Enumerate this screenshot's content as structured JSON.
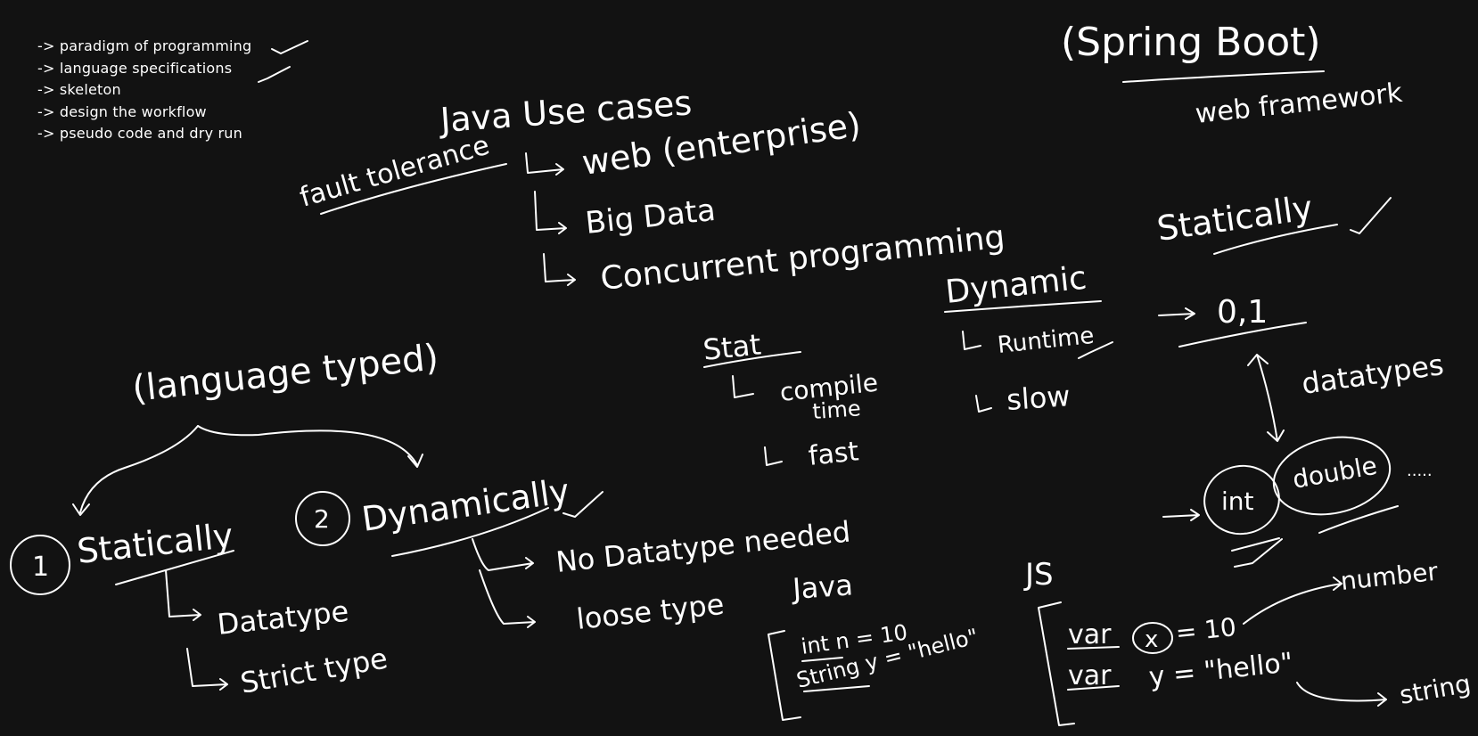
{
  "board": {
    "background": "#121212",
    "ink": "#ffffff",
    "checklist": [
      "-> paradigm of programming",
      "-> language specifications",
      "-> skeleton",
      "-> design the workflow",
      "-> pseudo code and dry run"
    ],
    "notes": {
      "spring_boot": "(Spring Boot)",
      "web_framework": "web framework",
      "java_use_cases": "Java Use cases",
      "fault_tolerance": "fault tolerance",
      "web_enterprise": "web (enterprise)",
      "big_data": "Big Data",
      "concurrent_programming": "Concurrent programming",
      "statically_top": "Statically",
      "dynamic": "Dynamic",
      "runtime": "Runtime",
      "slow": "slow",
      "stat": "Stat",
      "compile": "compile",
      "time": "time",
      "fast": "fast",
      "zero_one": "0,1",
      "datatypes": "datatypes",
      "int": "int",
      "double": "double",
      "ellipsis": ".....",
      "language_typed": "(language typed)",
      "num_1": "1",
      "statically": "Statically",
      "num_2": "2",
      "dynamically": "Dynamically",
      "no_datatype_needed": "No Datatype needed",
      "loose_type": "loose type",
      "datatype": "Datatype",
      "strict_type": "Strict type",
      "java": "Java",
      "java_line1": "int n = 10",
      "java_line2": "String y = \"hello\"",
      "js": "JS",
      "js_var1": "var",
      "js_x": "x",
      "js_eq10": "= 10",
      "js_var2": "var",
      "js_y": "y = \"hello\"",
      "number": "number",
      "string": "string"
    }
  }
}
